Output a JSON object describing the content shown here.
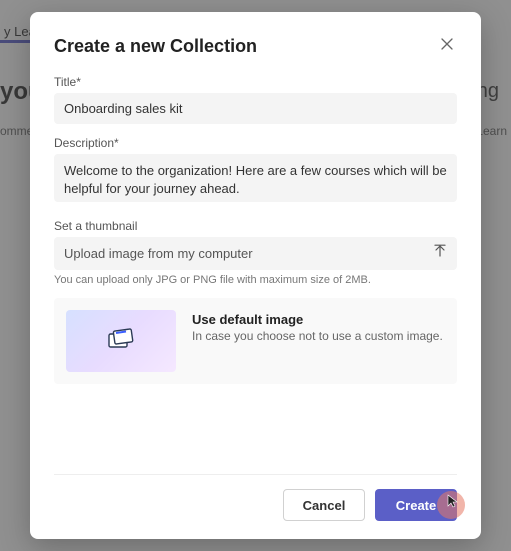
{
  "background": {
    "top_tab_fragment": "y Lear",
    "heading_fragment_left": "you",
    "heading_fragment_right": "ing",
    "subtext_left": "ommer",
    "subtext_right": "edIn Learn"
  },
  "modal": {
    "title": "Create a new Collection",
    "fields": {
      "title": {
        "label": "Title*",
        "value": "Onboarding sales kit"
      },
      "description": {
        "label": "Description*",
        "value": "Welcome to the organization! Here are a few courses which will be helpful for your journey ahead."
      },
      "thumbnail": {
        "label": "Set a thumbnail",
        "upload_text": "Upload image from my computer",
        "helper": "You can upload only JPG or PNG file with maximum size of 2MB."
      }
    },
    "default_image": {
      "title": "Use default image",
      "subtitle": "In case you choose not to use a custom image."
    },
    "footer": {
      "cancel": "Cancel",
      "create": "Create"
    }
  },
  "colors": {
    "accent": "#5b5fc7"
  }
}
